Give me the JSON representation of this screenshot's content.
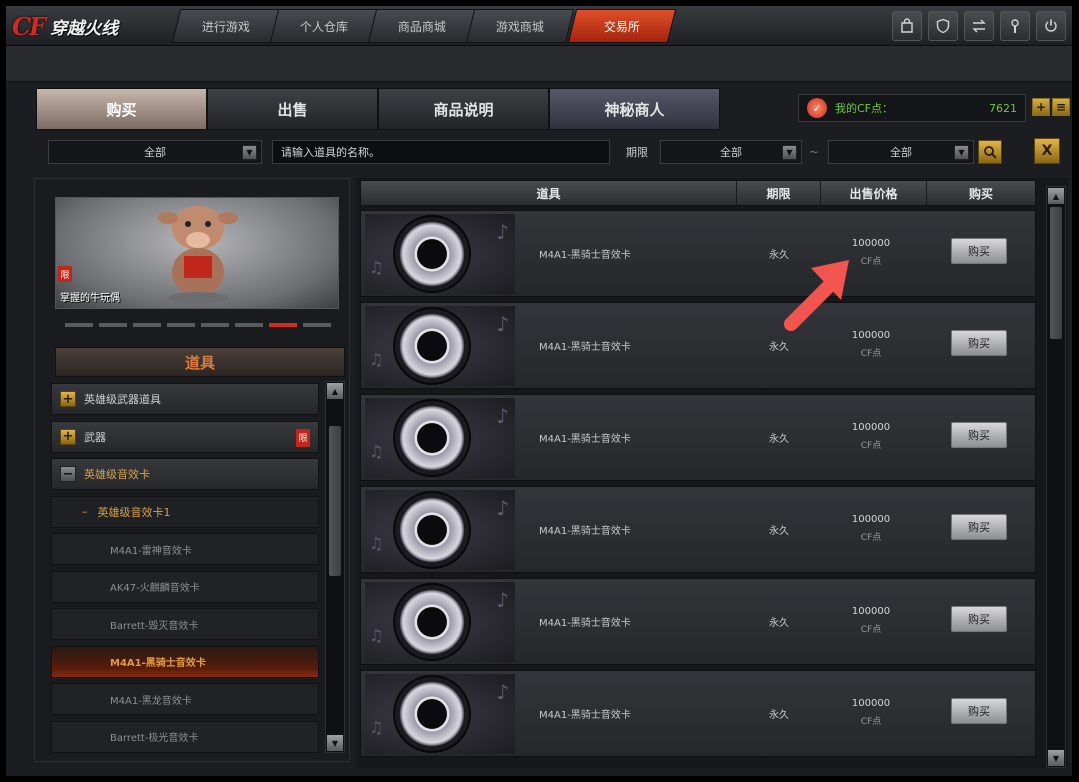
{
  "app": {
    "logo_cf": "CF",
    "logo_text": "穿越火线"
  },
  "nav": {
    "tabs": [
      {
        "label": "进行游戏"
      },
      {
        "label": "个人仓库"
      },
      {
        "label": "商品商城"
      },
      {
        "label": "游戏商城"
      },
      {
        "label": "交易所"
      }
    ],
    "active_index": 4
  },
  "market_tabs": [
    {
      "label": "购买"
    },
    {
      "label": "出售"
    },
    {
      "label": "商品说明"
    },
    {
      "label": "神秘商人"
    }
  ],
  "points": {
    "label": "我的CF点：",
    "value": "7621"
  },
  "filter": {
    "category_value": "全部",
    "search_placeholder": "请输入道具的名称。",
    "duration_label": "期限",
    "duration_value": "全部",
    "tilde": "~",
    "sort_value": "全部",
    "close_label": "X"
  },
  "preview": {
    "label": "掌握的牛玩偶",
    "badge": "限"
  },
  "category_header": "道具",
  "tree": [
    {
      "label": "英雄级武器道具",
      "type": "collapsed"
    },
    {
      "label": "武器",
      "type": "collapsed",
      "badge": "限"
    },
    {
      "label": "英雄级音效卡",
      "type": "open"
    },
    {
      "label": "英雄级音效卡1",
      "type": "sub1"
    },
    {
      "label": "M4A1-雷神音效卡",
      "type": "sub2"
    },
    {
      "label": "AK47-火麒麟音效卡",
      "type": "sub2"
    },
    {
      "label": "Barrett-毁灭音效卡",
      "type": "sub2"
    },
    {
      "label": "M4A1-黑骑士音效卡",
      "type": "sub2-selected"
    },
    {
      "label": "M4A1-黑龙音效卡",
      "type": "sub2"
    },
    {
      "label": "Barrett-极光音效卡",
      "type": "sub2"
    }
  ],
  "table": {
    "headers": [
      "道具",
      "期限",
      "出售价格",
      "购买"
    ],
    "rows": [
      {
        "name": "M4A1-黑骑士音效卡",
        "duration": "永久",
        "price": "100000",
        "unit": "CF点",
        "action": "购买"
      },
      {
        "name": "M4A1-黑骑士音效卡",
        "duration": "永久",
        "price": "100000",
        "unit": "CF点",
        "action": "购买"
      },
      {
        "name": "M4A1-黑骑士音效卡",
        "duration": "永久",
        "price": "100000",
        "unit": "CF点",
        "action": "购买"
      },
      {
        "name": "M4A1-黑骑士音效卡",
        "duration": "永久",
        "price": "100000",
        "unit": "CF点",
        "action": "购买"
      },
      {
        "name": "M4A1-黑骑士音效卡",
        "duration": "永久",
        "price": "100000",
        "unit": "CF点",
        "action": "购买"
      },
      {
        "name": "M4A1-黑骑士音效卡",
        "duration": "永久",
        "price": "100000",
        "unit": "CF点",
        "action": "购买"
      }
    ]
  },
  "icons": {
    "top_right": [
      "bag-icon",
      "shield-icon",
      "exchange-icon",
      "wrench-icon",
      "power-icon"
    ],
    "search": "search-icon",
    "arrow": "annotation-arrow-icon"
  },
  "colors": {
    "accent_red": "#d22b1f",
    "gold": "#e0b54c",
    "points_green": "#6bcb3d",
    "annotation_arrow": "#f2554f"
  }
}
